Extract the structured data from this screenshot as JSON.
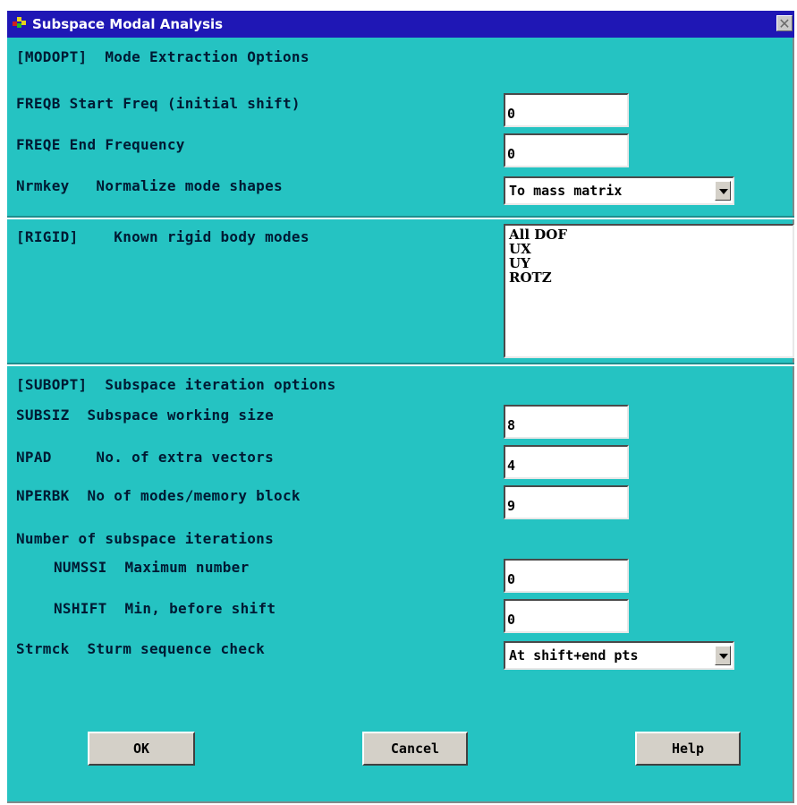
{
  "window": {
    "title": "Subspace Modal Analysis",
    "close_glyph": "✕"
  },
  "modopt": {
    "header": "[MODOPT]  Mode Extraction Options",
    "freqb_label": "FREQB Start Freq (initial shift)",
    "freqb_value": "0",
    "freqe_label": "FREQE End Frequency",
    "freqe_value": "0",
    "nrmkey_label": "Nrmkey   Normalize mode shapes",
    "nrmkey_value": "To mass matrix"
  },
  "rigid": {
    "header": "[RIGID]    Known rigid body modes",
    "options": [
      "All DOF",
      "UX",
      "UY",
      "ROTZ"
    ]
  },
  "subopt": {
    "header": "[SUBOPT]  Subspace iteration options",
    "subsiz_label": "SUBSIZ  Subspace working size",
    "subsiz_value": "8",
    "npad_label": "NPAD     No. of extra vectors",
    "npad_value": "4",
    "nperbk_label": "NPERBK  No of modes/memory block",
    "nperbk_value": "9",
    "iterations_label": "Number of subspace iterations",
    "numssi_label": "NUMSSI  Maximum number",
    "numssi_value": "0",
    "nshift_label": "NSHIFT  Min, before shift",
    "nshift_value": "0",
    "strmck_label": "Strmck  Sturm sequence check",
    "strmck_value": "At shift+end pts"
  },
  "buttons": {
    "ok": "OK",
    "cancel": "Cancel",
    "help": "Help"
  },
  "colors": {
    "title_bar": "#1f17b5",
    "dialog_bg": "#25c3c2",
    "button_face": "#d4d0c8"
  },
  "icons": [
    "app-icon",
    "close-icon",
    "dropdown-arrow-icon"
  ]
}
